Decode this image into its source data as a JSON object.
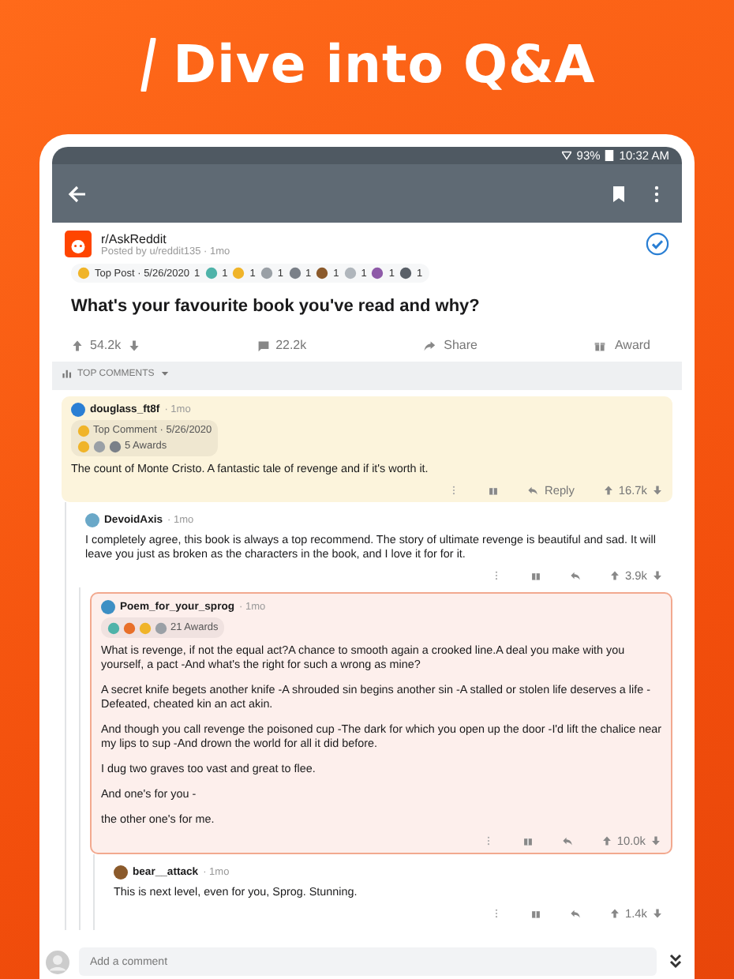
{
  "headline": "Dive into Q&A",
  "status_bar": {
    "battery": "93%",
    "time": "10:32 AM"
  },
  "post": {
    "subreddit": "r/AskReddit",
    "byline": "Posted by u/reddit135 · 1mo",
    "followed": true,
    "flair": {
      "label": "Top Post · 5/26/2020",
      "count": "1"
    },
    "awards": [
      {
        "count": "1",
        "color": "#4fb3a9"
      },
      {
        "count": "1",
        "color": "#f0b429"
      },
      {
        "count": "1",
        "color": "#9aa0a6"
      },
      {
        "count": "1",
        "color": "#7a8088"
      },
      {
        "count": "1",
        "color": "#8b5a2b"
      },
      {
        "count": "1",
        "color": "#b0b6bc"
      },
      {
        "count": "1",
        "color": "#8e5aa8"
      },
      {
        "count": "1",
        "color": "#5a6068"
      }
    ],
    "title": "What's your favourite book you've read and why?",
    "upvotes": "54.2k",
    "comments": "22.2k",
    "share": "Share",
    "award": "Award"
  },
  "sort": {
    "label": "TOP COMMENTS"
  },
  "comments": [
    {
      "author": "douglass_ft8f",
      "time": "· 1mo",
      "kind": "top",
      "color": "#2a7fd4",
      "flair": "Top Comment · 5/26/2020",
      "awards": [
        {
          "color": "#f0b429"
        },
        {
          "color": "#9aa0a6"
        },
        {
          "color": "#7a8088"
        }
      ],
      "awards_label": "5 Awards",
      "paragraphs": [
        "The count of Monte Cristo. A fantastic tale of revenge and if it's worth it."
      ],
      "reply": "Reply",
      "score": "16.7k",
      "children": [
        {
          "author": "DevoidAxis",
          "time": "· 1mo",
          "color": "#6aa8c8",
          "paragraphs": [
            "I completely agree, this book is always a top recommend.  The story of ultimate revenge is beautiful and sad. It will leave you just as broken as the characters in the book, and I love it for for it."
          ],
          "score": "3.9k",
          "children": [
            {
              "author": "Poem_for_your_sprog",
              "time": "· 1mo",
              "kind": "op",
              "color": "#3d8fc4",
              "awards": [
                {
                  "color": "#4fb3a9"
                },
                {
                  "color": "#e8702a"
                },
                {
                  "color": "#f0b429"
                },
                {
                  "color": "#9aa0a6"
                }
              ],
              "awards_label": "21 Awards",
              "paragraphs": [
                "What is revenge, if not the equal act?A chance to smooth again a crooked line.A deal you make with you yourself, a pact -And what's the right for such a wrong as mine?",
                "A secret knife begets another knife -A shrouded sin begins another sin -A stalled or stolen life deserves a life -Defeated, cheated kin an act akin.",
                "And though you call revenge the poisoned cup -The dark for which you open up the door -I'd lift the chalice near my lips to sup -And drown the world for all it did before.",
                "I dug two graves too vast and great to flee.",
                "And one's for you -",
                "the other one's for me."
              ],
              "score": "10.0k",
              "children": [
                {
                  "author": "bear__attack",
                  "time": "· 1mo",
                  "color": "#8b5a2b",
                  "paragraphs": [
                    "This is next level, even for you, Sprog. Stunning."
                  ],
                  "score": "1.4k"
                }
              ]
            }
          ]
        }
      ]
    }
  ],
  "composer": {
    "placeholder": "Add a comment"
  }
}
